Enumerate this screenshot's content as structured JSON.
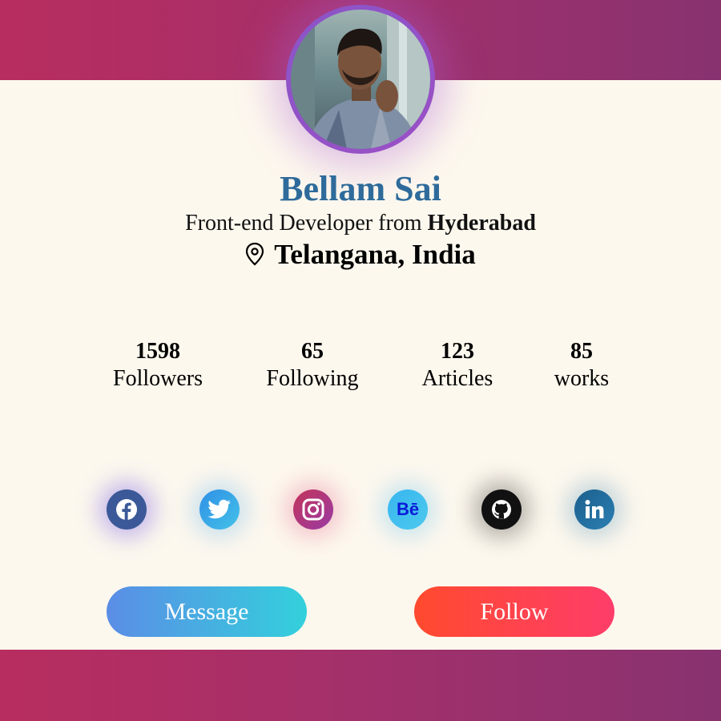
{
  "profile": {
    "name": "Bellam Sai",
    "subtitle_prefix": "Front-end Developer from ",
    "subtitle_city": "Hyderabad",
    "location": "Telangana, India"
  },
  "stats": [
    {
      "value": "1598",
      "label": "Followers"
    },
    {
      "value": "65",
      "label": "Following"
    },
    {
      "value": "123",
      "label": "Articles"
    },
    {
      "value": "85",
      "label": "works"
    }
  ],
  "social": [
    {
      "icon": "facebook-icon",
      "color": "#3b5998"
    },
    {
      "icon": "twitter-icon",
      "color": "#1da1f2"
    },
    {
      "icon": "instagram-icon",
      "color": "#c13584"
    },
    {
      "icon": "behance-icon",
      "color": "#1769ff",
      "glyph": "Bē"
    },
    {
      "icon": "github-icon",
      "color": "#111111"
    },
    {
      "icon": "linkedin-icon",
      "color": "#1f6b9c"
    }
  ],
  "buttons": {
    "message_label": "Message",
    "follow_label": "Follow"
  },
  "colors": {
    "band_gradient_start": "#b82d5f",
    "band_gradient_end": "#883270",
    "name_color": "#2e6b9b",
    "background": "#fdf8ee"
  }
}
